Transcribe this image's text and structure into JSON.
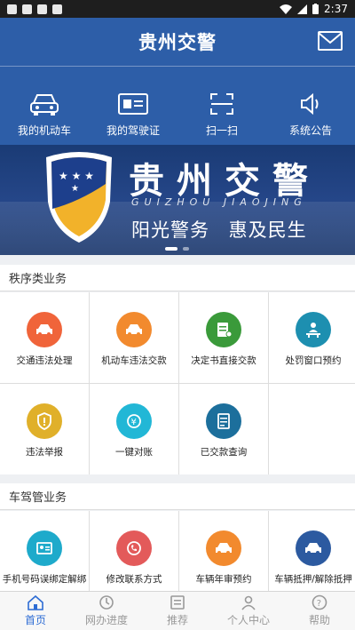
{
  "status_bar": {
    "time": "2:37"
  },
  "header": {
    "title": "贵州交警"
  },
  "quick_actions": [
    {
      "label": "我的机动车",
      "icon": "car-icon"
    },
    {
      "label": "我的驾驶证",
      "icon": "license-card-icon"
    },
    {
      "label": "扫一扫",
      "icon": "scan-icon"
    },
    {
      "label": "系统公告",
      "icon": "speaker-icon"
    }
  ],
  "banner": {
    "title": "贵州交警",
    "pinyin": "GUIZHOU JIAOJING",
    "slogan": "阳光警务 惠及民生"
  },
  "sections": [
    {
      "title": "秩序类业务",
      "items": [
        {
          "label": "交通违法处理",
          "color": "#f0643a",
          "icon": "car-icon"
        },
        {
          "label": "机动车违法交款",
          "color": "#f28a2e",
          "icon": "car-icon"
        },
        {
          "label": "决定书直接交款",
          "color": "#3a9a3a",
          "icon": "document-icon"
        },
        {
          "label": "处罚窗口预约",
          "color": "#1d8fb0",
          "icon": "person-desk-icon"
        },
        {
          "label": "违法举报",
          "color": "#e0b02a",
          "icon": "shield-icon"
        },
        {
          "label": "一键对账",
          "color": "#22b7d6",
          "icon": "yuan-icon"
        },
        {
          "label": "已交款查询",
          "color": "#1c6f9c",
          "icon": "receipt-icon"
        }
      ]
    },
    {
      "title": "车驾管业务",
      "items": [
        {
          "label": "手机号码误绑定解绑",
          "color": "#1eaacb",
          "icon": "id-card-icon"
        },
        {
          "label": "修改联系方式",
          "color": "#e35a5a",
          "icon": "phone-icon"
        },
        {
          "label": "车辆年审预约",
          "color": "#f28a2e",
          "icon": "car-icon"
        },
        {
          "label": "车辆抵押/解除抵押",
          "color": "#2c5aa0",
          "icon": "car-icon"
        }
      ]
    }
  ],
  "tabs": [
    {
      "label": "首页",
      "icon": "home-icon",
      "active": true
    },
    {
      "label": "网办进度",
      "icon": "progress-icon",
      "active": false
    },
    {
      "label": "推荐",
      "icon": "recommend-icon",
      "active": false
    },
    {
      "label": "个人中心",
      "icon": "person-icon",
      "active": false
    },
    {
      "label": "帮助",
      "icon": "help-icon",
      "active": false
    }
  ]
}
